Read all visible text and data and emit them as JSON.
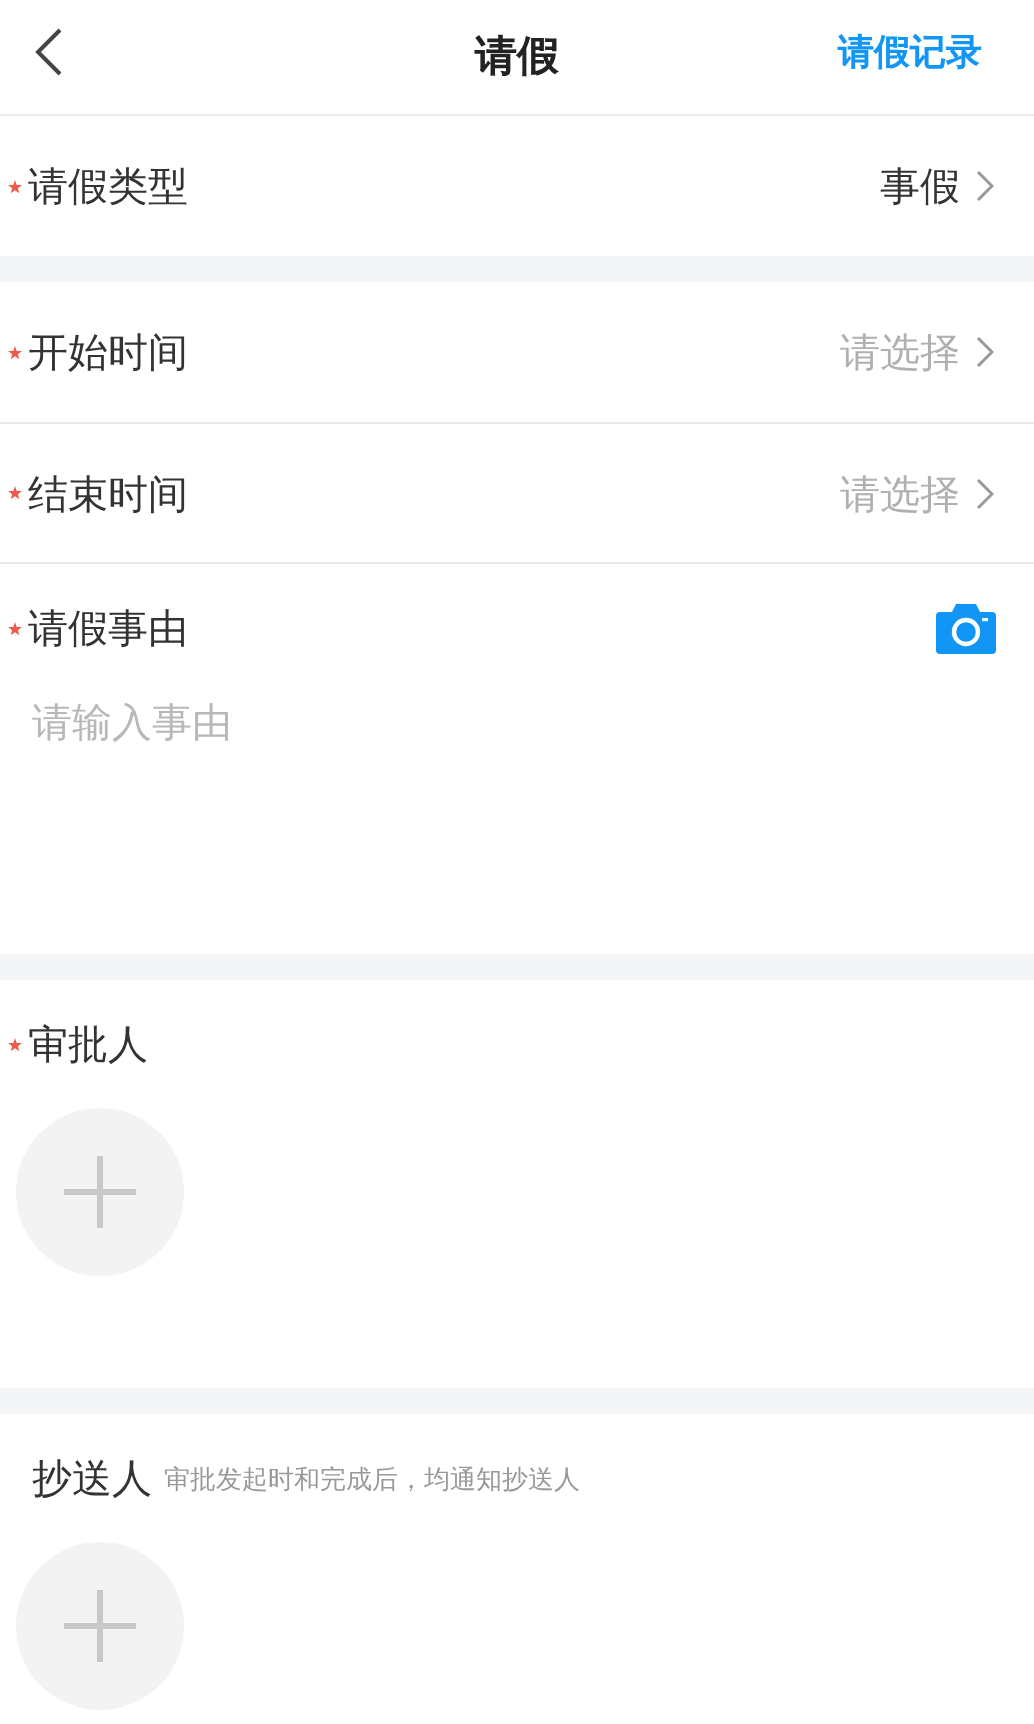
{
  "header": {
    "title": "请假",
    "action": "请假记录"
  },
  "sections": [
    {
      "fields": [
        {
          "kind": "select",
          "label": "请假类型",
          "required": true,
          "value": "事假"
        }
      ]
    },
    {
      "fields": [
        {
          "kind": "select",
          "label": "开始时间",
          "required": true,
          "placeholder": "请选择"
        },
        {
          "kind": "select",
          "label": "结束时间",
          "required": true,
          "placeholder": "请选择"
        },
        {
          "kind": "text",
          "label": "请假事由",
          "required": true,
          "placeholder": "请输入事由"
        }
      ]
    },
    {
      "fields": [
        {
          "kind": "people",
          "label": "审批人",
          "required": true
        }
      ]
    },
    {
      "fields": [
        {
          "kind": "people",
          "label": "抄送人",
          "required": false,
          "hint": "审批发起时和完成后，均通知抄送人"
        }
      ]
    }
  ]
}
